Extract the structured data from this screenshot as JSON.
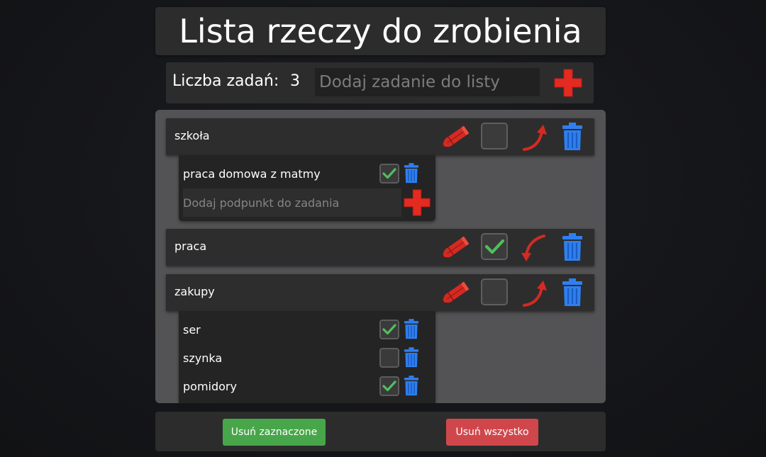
{
  "header": {
    "title": "Lista rzeczy do zrobienia"
  },
  "add_bar": {
    "count_label": "Liczba zadań:",
    "count_value": "3",
    "input_placeholder": "Dodaj zadanie do listy",
    "add_icon": "plus-icon"
  },
  "tasks": [
    {
      "label": "szkoła",
      "checked": false,
      "arrow_direction": "up",
      "subtasks": [
        {
          "label": "praca domowa z matmy",
          "checked": true
        }
      ],
      "subtask_placeholder": "Dodaj podpunkt do zadania"
    },
    {
      "label": "praca",
      "checked": true,
      "arrow_direction": "down",
      "subtasks": []
    },
    {
      "label": "zakupy",
      "checked": false,
      "arrow_direction": "up",
      "subtasks": [
        {
          "label": "ser",
          "checked": true
        },
        {
          "label": "szynka",
          "checked": false
        },
        {
          "label": "pomidory",
          "checked": true
        }
      ]
    }
  ],
  "footer": {
    "remove_checked_label": "Usuń zaznaczone",
    "remove_all_label": "Usuń wszystko"
  },
  "colors": {
    "accent_red": "#e32b22",
    "trash_blue": "#2f7ff0",
    "check_green": "#4fc05a",
    "button_green": "#48a64a",
    "button_red": "#d0474b"
  }
}
